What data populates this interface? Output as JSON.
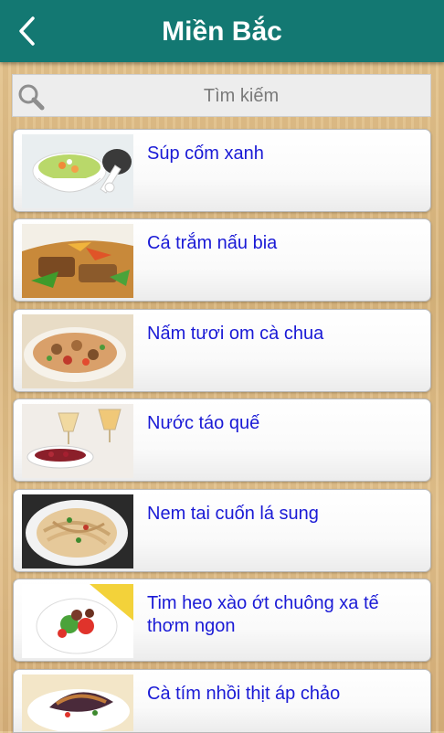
{
  "header": {
    "title": "Miền Bắc",
    "back_icon": "chevron-left-icon"
  },
  "search": {
    "placeholder": "Tìm kiếm",
    "icon": "search-icon"
  },
  "colors": {
    "appbar": "#137872",
    "item_text": "#1a1ad6"
  },
  "recipes": [
    {
      "name": "Súp cốm xanh"
    },
    {
      "name": "Cá trắm nấu bia"
    },
    {
      "name": "Nấm tươi om cà chua"
    },
    {
      "name": "Nước táo quế"
    },
    {
      "name": "Nem tai cuốn lá sung"
    },
    {
      "name": "Tim heo xào ớt chuông xa tế thơm ngon"
    },
    {
      "name": "Cà tím nhồi thịt áp chảo"
    }
  ]
}
